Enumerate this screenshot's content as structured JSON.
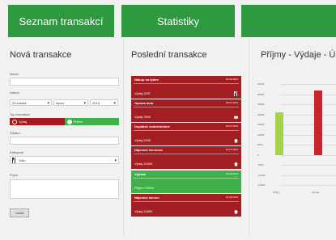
{
  "tabs": [
    {
      "label": "Seznam transakcí"
    },
    {
      "label": "Statistiky"
    },
    {
      "label": ""
    }
  ],
  "form": {
    "title": "Nová transakce",
    "name_label": "Název",
    "date_label": "Datum",
    "date_day": "03 sobota",
    "date_month": "srpen",
    "date_year": "2013",
    "type_label": "Typ transakce",
    "type_expense": "Výdaj",
    "type_income": "Příjem",
    "amount_label": "Částka",
    "category_label": "Kategorie",
    "category_value": "Jídlo",
    "note_label": "Popis",
    "save_label": "Uložit"
  },
  "recent": {
    "title": "Poslední transakce",
    "items": [
      {
        "title": "Nákup na týden",
        "date": "03.08.2013",
        "amount": "Výdaj   1537",
        "icon": "fork-knife-icon",
        "kind": "expense"
      },
      {
        "title": "Oprava auta",
        "date": "09.07.2013",
        "amount": "Výdaj   7900",
        "icon": "car-icon",
        "kind": "expense"
      },
      {
        "title": "Doplatek vodné/stočné",
        "date": "04.07.2013",
        "amount": "Výdaj   2400",
        "icon": "house-icon",
        "kind": "expense"
      },
      {
        "title": "Nájemné červenec",
        "date": "01.07.2013",
        "amount": "Výdaj   10500",
        "icon": "house-icon",
        "kind": "expense"
      },
      {
        "title": "Výplata",
        "date": "04.06.2013",
        "amount": "Příjem   21000",
        "icon": "",
        "kind": "income"
      },
      {
        "title": "Nájemné červen",
        "date": "01.06.2013",
        "amount": "Výdaj   10500",
        "icon": "house-icon",
        "kind": "expense"
      }
    ]
  },
  "chart": {
    "title": "Příjmy - Výdaje - Úsp"
  },
  "chart_data": {
    "type": "bar",
    "categories": [
      "Příjmy",
      "Výdaje"
    ],
    "values": [
      21000,
      32000
    ],
    "colors": [
      "#a8d14b",
      "#c9242c"
    ],
    "ylim": [
      -15000,
      35000
    ],
    "ytick_labels": [
      "35000",
      "30000",
      "25000",
      "20000",
      "15000",
      "10000",
      "5000",
      "0",
      "-5000",
      "-10000",
      "-15000"
    ],
    "grid": true
  }
}
